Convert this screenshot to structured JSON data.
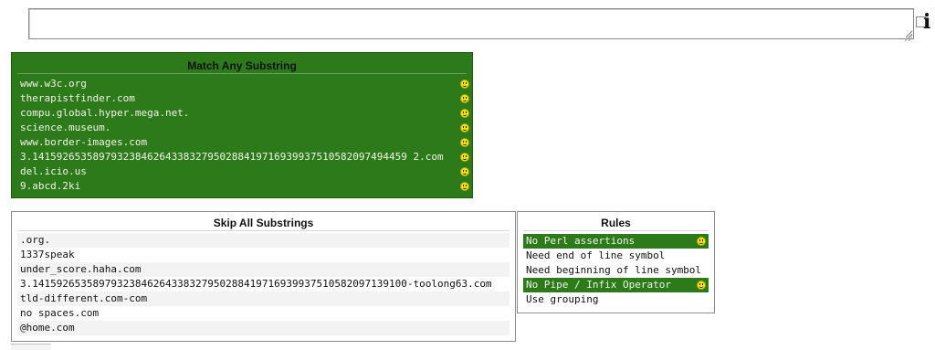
{
  "regex_input": {
    "value": "",
    "info_glyph": "i"
  },
  "match_panel": {
    "title": "Match Any Substring",
    "items": [
      "www.w3c.org",
      "therapistfinder.com",
      "compu.global.hyper.mega.net.",
      "science.museum.",
      "www.border-images.com",
      "3.14159265358979323846264338327950288419716939937510582097494459 2.com",
      "del.icio.us",
      "9.abcd.2ki"
    ],
    "status_icon": "smiley-icon"
  },
  "skip_panel": {
    "title": "Skip All Substrings",
    "items": [
      ".org.",
      "1337speak",
      "under_score.haha.com",
      "3.14159265358979323846264338327950288419716939937510582097139100-toolong63.com",
      "tld-different.com-com",
      "no spaces.com",
      "@home.com"
    ]
  },
  "rules_panel": {
    "title": "Rules",
    "items": [
      {
        "label": "No Perl assertions",
        "passed": true
      },
      {
        "label": "Need end of line symbol",
        "passed": false
      },
      {
        "label": "Need beginning of line symbol",
        "passed": false
      },
      {
        "label": "No Pipe / Infix Operator",
        "passed": true
      },
      {
        "label": "Use grouping",
        "passed": false
      }
    ]
  },
  "colors": {
    "pass_green": "#2d7a1b",
    "smiley_yellow": "#f4e11d"
  }
}
